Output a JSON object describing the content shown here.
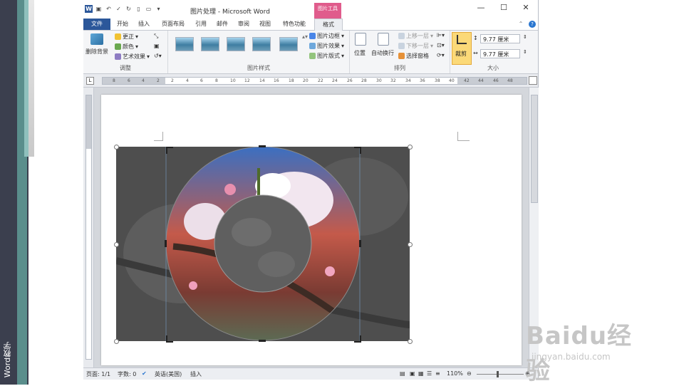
{
  "side_label": "Word教学",
  "window": {
    "title": "图片处理 - Microsoft Word",
    "qat_icons": [
      "word-logo-icon",
      "save-icon",
      "undo-icon",
      "check-icon",
      "redo-icon",
      "new-doc-icon",
      "screenshot-icon",
      "dropdown-icon"
    ],
    "controls": {
      "minimize": "—",
      "restore": "☐",
      "close": "✕"
    },
    "context_tab_header": "图片工具"
  },
  "tabs": [
    {
      "id": "file",
      "label": "文件",
      "active": false
    },
    {
      "id": "home",
      "label": "开始",
      "active": false
    },
    {
      "id": "insert",
      "label": "插入",
      "active": false
    },
    {
      "id": "page_layout",
      "label": "页面布局",
      "active": false
    },
    {
      "id": "references",
      "label": "引用",
      "active": false
    },
    {
      "id": "mailings",
      "label": "邮件",
      "active": false
    },
    {
      "id": "review",
      "label": "审阅",
      "active": false
    },
    {
      "id": "view",
      "label": "视图",
      "active": false
    },
    {
      "id": "special",
      "label": "特色功能",
      "active": false
    },
    {
      "id": "format",
      "label": "格式",
      "active": true
    }
  ],
  "ribbon": {
    "adjust": {
      "label": "调整",
      "remove_bg": "删除背景",
      "corrections": "更正",
      "color": "颜色",
      "artistic": "艺术效果"
    },
    "styles": {
      "label": "图片样式",
      "border": "图片边框",
      "effects": "图片效果",
      "layout": "图片版式"
    },
    "arrange": {
      "label": "排列",
      "position": "位置",
      "wrap": "自动换行",
      "bring_forward": "上移一层",
      "send_backward": "下移一层",
      "selection_pane": "选择窗格"
    },
    "size": {
      "label": "大小",
      "crop": "裁剪",
      "height": "9.77 厘米",
      "width": "9.77 厘米"
    }
  },
  "ruler": {
    "ticks": [
      "8",
      "6",
      "4",
      "2",
      "2",
      "4",
      "6",
      "8",
      "10",
      "12",
      "14",
      "16",
      "18",
      "20",
      "22",
      "24",
      "26",
      "28",
      "30",
      "32",
      "34",
      "36",
      "38",
      "40",
      "42",
      "44",
      "46",
      "48"
    ]
  },
  "statusbar": {
    "page": "页面: 1/1",
    "words": "字数: 0",
    "language": "英语(美国)",
    "mode": "插入",
    "zoom": "110%"
  },
  "watermark": {
    "brand": "Baidu经验",
    "url": "jingyan.baidu.com"
  },
  "colors": {
    "word_blue": "#2b579a",
    "picture_tools_pink": "#e05c8c",
    "crop_highlight": "#fbd978",
    "side_dark": "#3b3f4e",
    "side_teal": "#5a8e8c"
  }
}
